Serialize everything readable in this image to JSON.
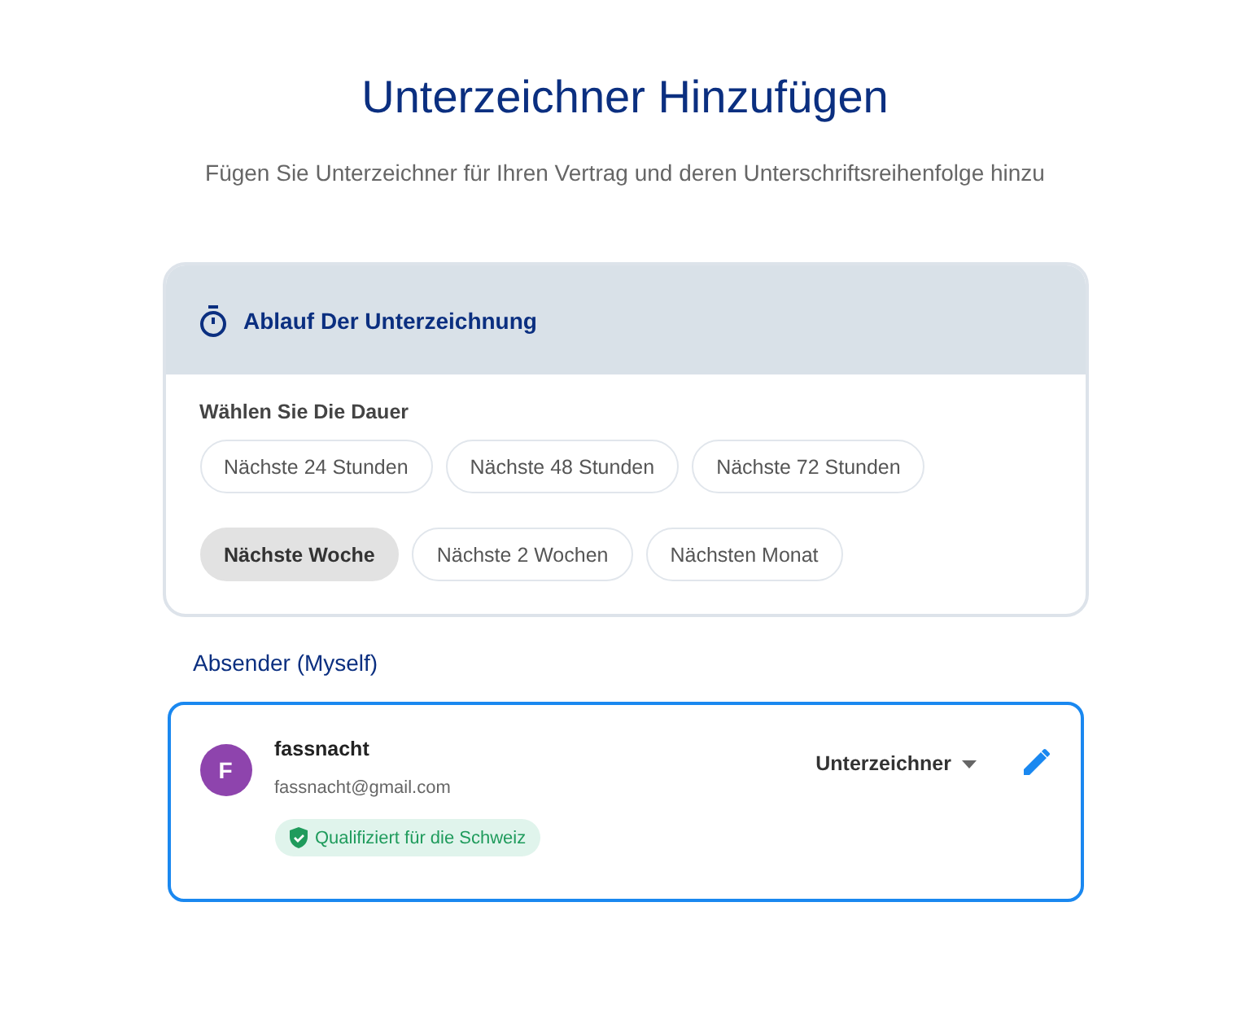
{
  "header": {
    "title": "Unterzeichner Hinzufügen",
    "subtitle": "Fügen Sie Unterzeichner für Ihren Vertrag und deren Unterschriftsreihenfolge hinzu"
  },
  "expiry_card": {
    "title": "Ablauf Der Unterzeichnung",
    "label": "Wählen Sie Die Dauer",
    "options": [
      {
        "label": "Nächste 24 Stunden",
        "selected": false
      },
      {
        "label": "Nächste 48 Stunden",
        "selected": false
      },
      {
        "label": "Nächste 72 Stunden",
        "selected": false
      },
      {
        "label": "Nächste Woche",
        "selected": true
      },
      {
        "label": "Nächste 2 Wochen",
        "selected": false
      },
      {
        "label": "Nächsten Monat",
        "selected": false
      }
    ]
  },
  "sender": {
    "heading": "Absender (Myself)",
    "initial": "F",
    "name": "fassnacht",
    "email": "fassnacht@gmail.com",
    "badge": "Qualifiziert für die Schweiz",
    "role": "Unterzeichner"
  }
}
